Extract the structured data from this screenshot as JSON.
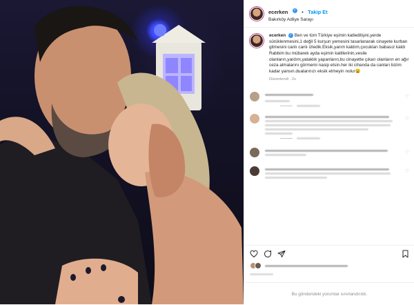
{
  "post": {
    "header": {
      "username": "ecerken",
      "verified_mark": "✓",
      "separator": "•",
      "follow_label": "Takip Et",
      "location": "Bakırköy Adliye Sarayı",
      "more_glyph": "•••"
    },
    "caption": {
      "username": "ecerken",
      "text": "Ben ve tüm Türkiye eşimin katledilişini,yerde sürüklenmesini,1 değil 5 kurşun yemesini tasarlanarak cinayete kurban gitmesini canlı canlı izledik.Eksik,yarım kaldım,çocukları babasız kaldı Rabbim bu mübarek ayda eşimin katillerinin,vesile olanların,yardım,yataklık yapanların,bu cinayette çıkarı olanların en ağır ceza almalarını görmemi nasip etsin.her iki cihanda da canları bizim kadar yansın.dualarınızı eksik etmeyin nolur😩",
      "edited_label": "Düzenlendi · 2s"
    },
    "comments": [
      {
        "username_blurred": true,
        "lines": 1,
        "has_reply_link": true
      },
      {
        "username_blurred": true,
        "lines": 4,
        "has_reply_link": true
      },
      {
        "username_blurred": true,
        "lines": 2,
        "has_reply_link": false
      },
      {
        "username_blurred": true,
        "lines": 3,
        "has_reply_link": false
      }
    ],
    "comments_closed": "Bu gönderideki yorumlar sınırlandırıldı."
  },
  "icons": {
    "like": "heart-icon",
    "comment": "comment-icon",
    "share": "share-icon",
    "save": "bookmark-icon",
    "verified": "verified-badge-icon",
    "more": "more-options-icon"
  },
  "colors": {
    "follow_blue": "#0095f6",
    "verified_blue": "#3897f0",
    "muted_text": "#8e8e8e",
    "border": "#efefef",
    "photo_light": "#3b4cff"
  }
}
